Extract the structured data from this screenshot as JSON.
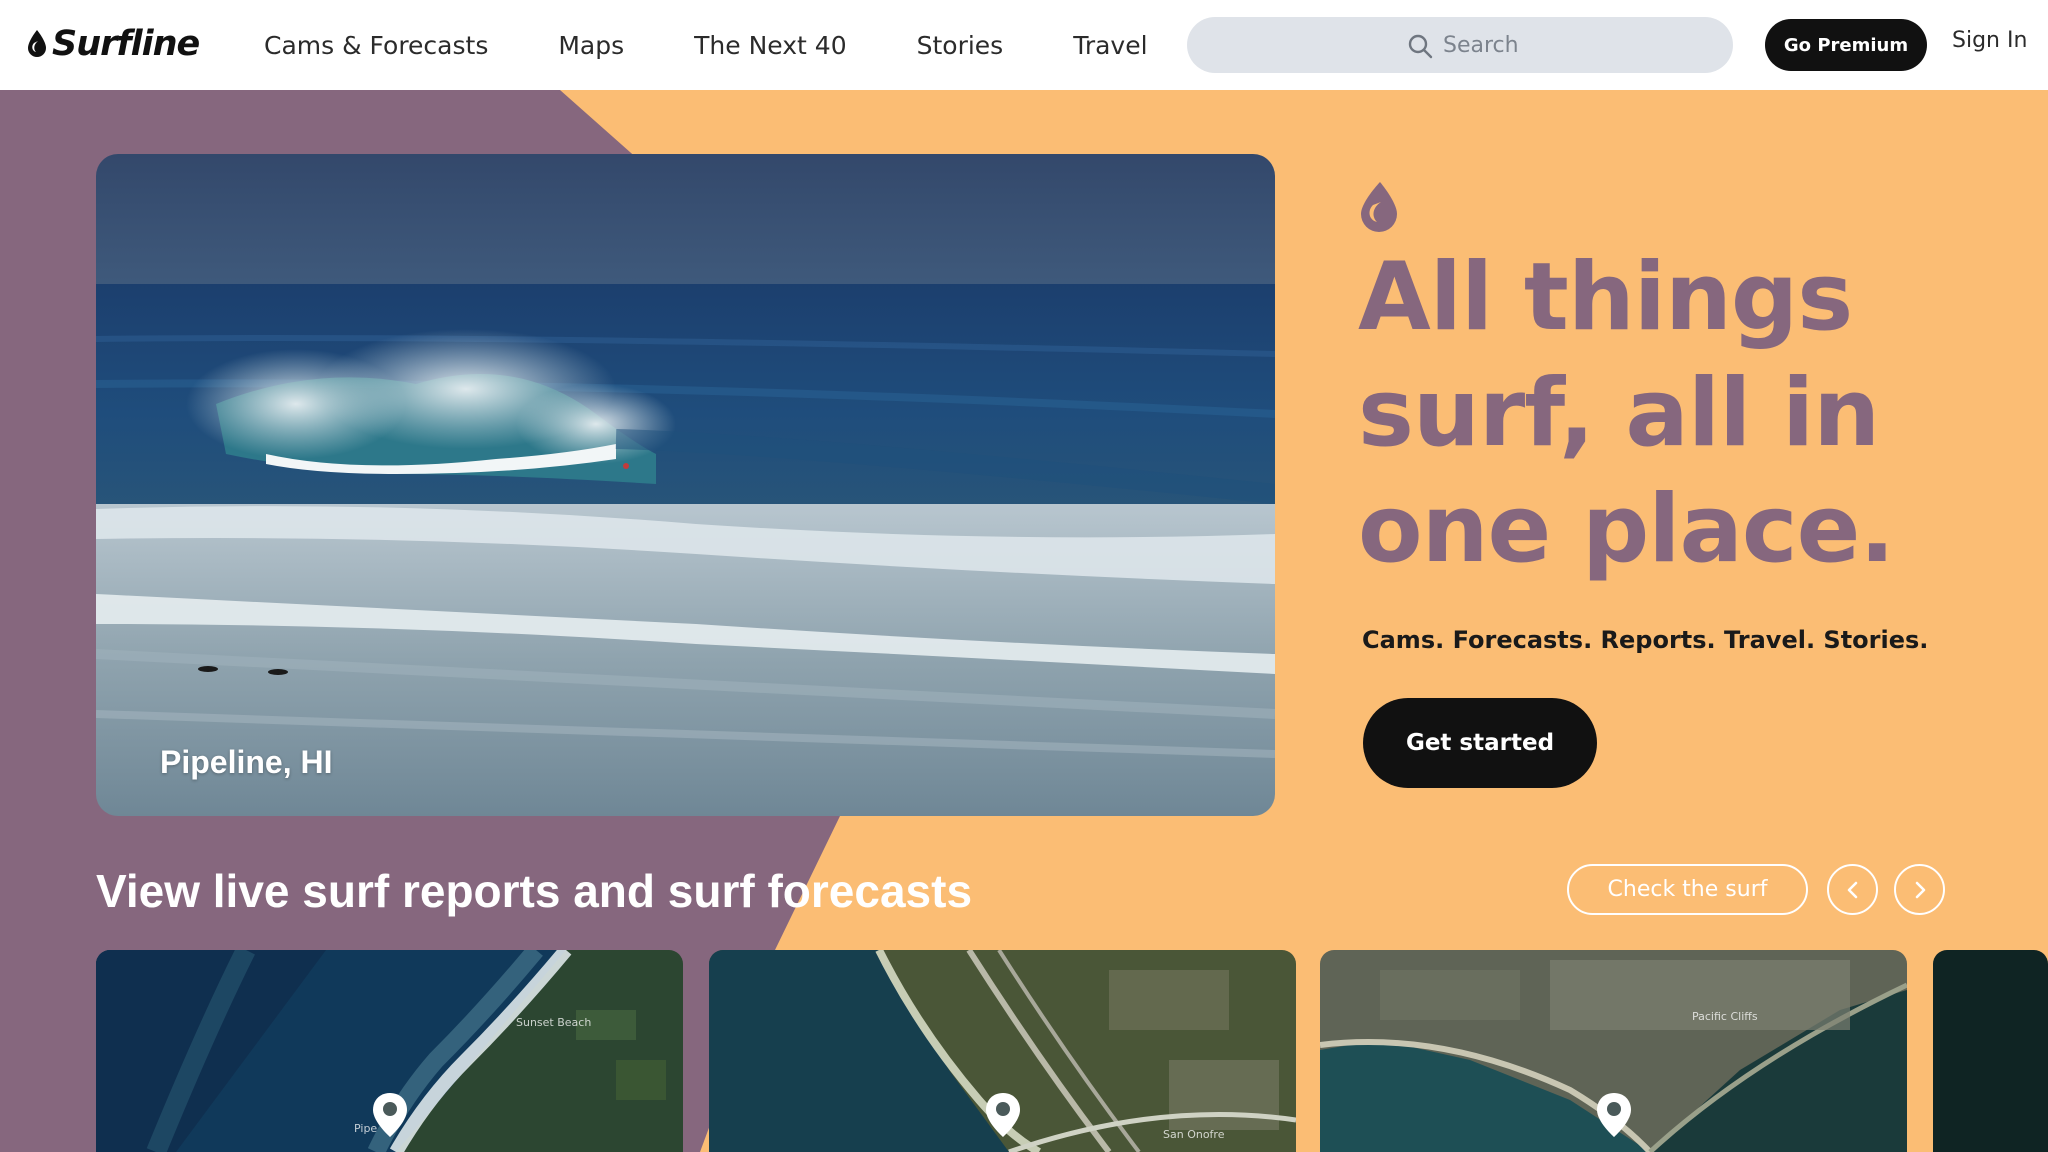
{
  "header": {
    "logo_text": "Surfline",
    "nav": [
      "Cams & Forecasts",
      "Maps",
      "The Next 40",
      "Stories",
      "Travel"
    ],
    "search_placeholder": "Search",
    "premium_label": "Go Premium",
    "signin_label": "Sign In"
  },
  "hero": {
    "caption": "Pipeline, HI",
    "headline": [
      "All things",
      "surf, all in",
      "one place."
    ],
    "subline": "Cams. Forecasts. Reports. Travel. Stories.",
    "cta_label": "Get started"
  },
  "live": {
    "title": "View live surf reports and surf forecasts",
    "check_label": "Check the surf",
    "cards": [
      {
        "map_label": "Sunset Beach",
        "map_label_2": "Pipe"
      },
      {
        "map_label": "San Onofre"
      },
      {
        "map_label": "Pacific Cliffs"
      }
    ]
  },
  "colors": {
    "orange": "#fbbd74",
    "mauve": "#86677e",
    "black": "#111111",
    "search_bg": "#dfe3e9"
  },
  "icons": [
    "surfline-drop-icon",
    "search-icon",
    "chevron-left-icon",
    "chevron-right-icon",
    "map-pin-icon"
  ]
}
